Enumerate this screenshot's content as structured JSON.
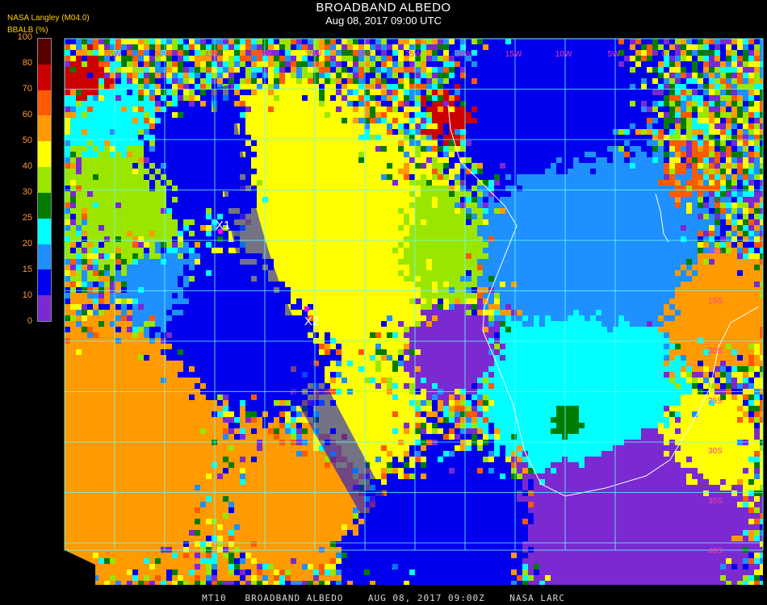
{
  "header": {
    "title": "BROADBAND ALBEDO",
    "subtitle": "Aug 08, 2017 09:00 UTC",
    "agency": "NASA Langley (M04.0)",
    "unit_label": "BBALB (%)"
  },
  "colorbar": {
    "ticks": [
      "100",
      "80",
      "70",
      "60",
      "50",
      "40",
      "30",
      "25",
      "20",
      "15",
      "10",
      "0"
    ],
    "colors": [
      "#5a0000",
      "#cc0000",
      "#ff5a00",
      "#ff9a00",
      "#ffff00",
      "#9be600",
      "#007d00",
      "#00ffff",
      "#1e90ff",
      "#0000ee",
      "#7a2ad0"
    ]
  },
  "markers": [
    {
      "label": "X1",
      "color": "#ff00ff"
    },
    {
      "label": "X2",
      "color": "#ff00ff"
    }
  ],
  "map": {
    "grid_color": "#66ffff",
    "coast_color": "#ffffff",
    "lon_labels": [
      "55W",
      "50W",
      "45W",
      "40W",
      "35W",
      "30W",
      "25W",
      "20W",
      "15W",
      "10W",
      "5W",
      "0"
    ],
    "lat_labels": [
      "5S",
      "10S",
      "15S",
      "20S",
      "25S",
      "30S",
      "35S",
      "40S"
    ]
  },
  "footer": "MT10   BROADBAND ALBEDO    AUG 08, 2017 09:00Z    NASA LARC"
}
